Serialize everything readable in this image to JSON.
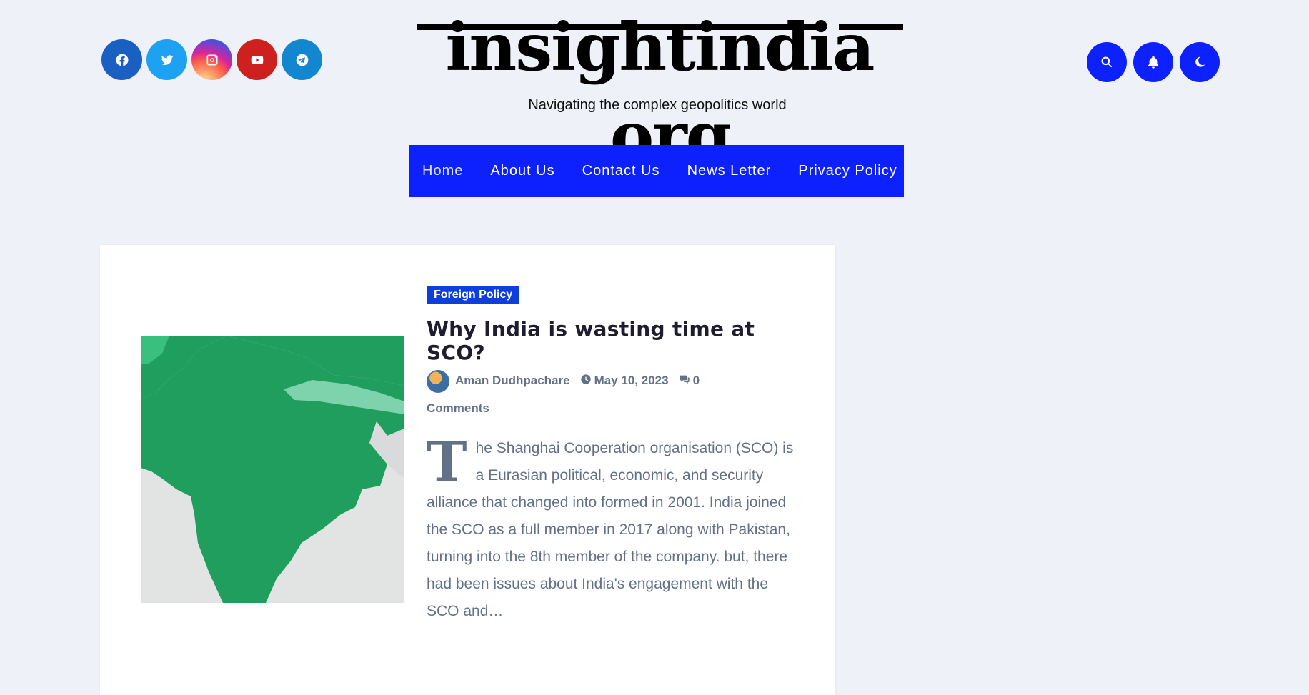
{
  "site": {
    "logo_text": "insightindia .org",
    "tagline": "Navigating the complex geopolitics world"
  },
  "social": [
    {
      "name": "facebook",
      "icon": "facebook-icon",
      "color": "#1a5fc2"
    },
    {
      "name": "twitter",
      "icon": "twitter-icon",
      "color": "#1da1f2"
    },
    {
      "name": "instagram",
      "icon": "instagram-icon",
      "color": "#d6249f"
    },
    {
      "name": "youtube",
      "icon": "youtube-icon",
      "color": "#cd201f"
    },
    {
      "name": "telegram",
      "icon": "telegram-icon",
      "color": "#1287cf"
    }
  ],
  "tools": [
    {
      "icon": "search-icon"
    },
    {
      "icon": "bell-icon"
    },
    {
      "icon": "moon-icon"
    }
  ],
  "nav": {
    "items": [
      "Home",
      "About Us",
      "Contact Us",
      "News Letter",
      "Privacy Policy"
    ],
    "accent": "#0d21ff"
  },
  "post": {
    "category": "Foreign Policy",
    "title": "Why India is wasting time at SCO?",
    "author": "Aman Dudhpachare",
    "date": "May 10, 2023",
    "comments": "0 Comments",
    "dropcap": "T",
    "excerpt_rest": "he Shanghai Cooperation organisation (SCO) is a Eurasian political, economic, and security alliance that changed into formed in 2001. India joined the SCO as a full member in 2017 along with Pakistan, turning into the 8th member of the company. but, there had been issues about India's engagement with the SCO and…",
    "image_icon": "india-map-image"
  }
}
